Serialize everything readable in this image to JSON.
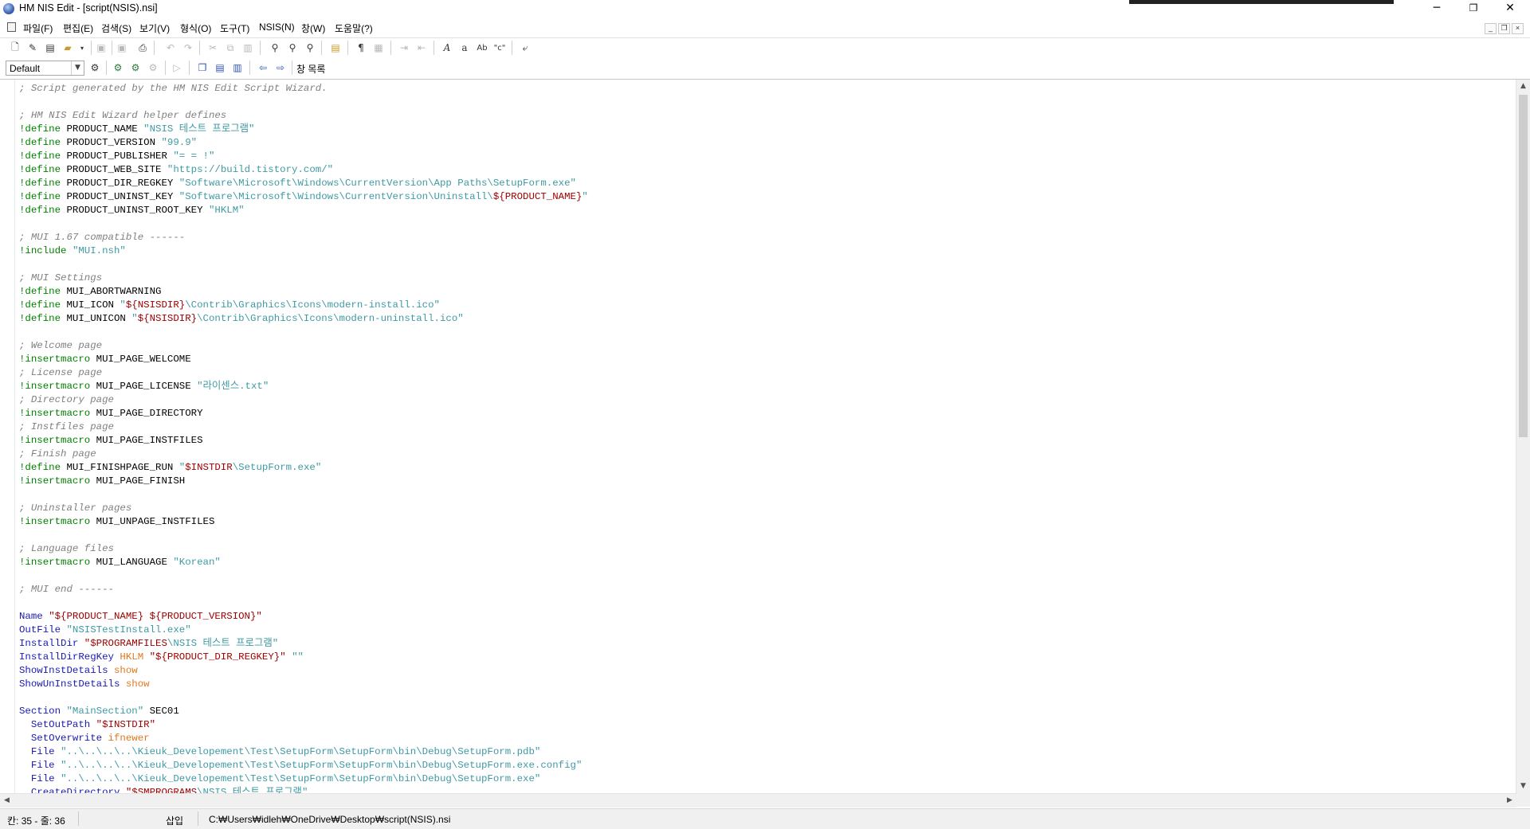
{
  "window": {
    "title": "HM NIS Edit - [script(NSIS).nsi]",
    "minimize": "─",
    "maximize": "❐",
    "close": "✕"
  },
  "menu": {
    "items": [
      "파일(F)",
      "편집(E)",
      "검색(S)",
      "보기(V)",
      "형식(O)",
      "도구(T)",
      "NSIS(N)",
      "창(W)",
      "도움말(?)"
    ],
    "mdi_min": "_",
    "mdi_restore": "❐",
    "mdi_close": "×"
  },
  "toolbar": {
    "style_combo": "Default",
    "window_list": "창 목록"
  },
  "editor": {
    "lines": [
      [
        [
          "c-com",
          "; Script generated by the HM NIS Edit Script Wizard."
        ]
      ],
      [],
      [
        [
          "c-com",
          "; HM NIS Edit Wizard helper defines"
        ]
      ],
      [
        [
          "c-kw",
          "!define"
        ],
        [
          "",
          " PRODUCT_NAME "
        ],
        [
          "c-str",
          "\"NSIS 테스트 프로그램\""
        ]
      ],
      [
        [
          "c-kw",
          "!define"
        ],
        [
          "",
          " PRODUCT_VERSION "
        ],
        [
          "c-str",
          "\"99.9\""
        ]
      ],
      [
        [
          "c-kw",
          "!define"
        ],
        [
          "",
          " PRODUCT_PUBLISHER "
        ],
        [
          "c-str",
          "\"= = !\""
        ]
      ],
      [
        [
          "c-kw",
          "!define"
        ],
        [
          "",
          " PRODUCT_WEB_SITE "
        ],
        [
          "c-str",
          "\"https://build.tistory.com/\""
        ]
      ],
      [
        [
          "c-kw",
          "!define"
        ],
        [
          "",
          " PRODUCT_DIR_REGKEY "
        ],
        [
          "c-str",
          "\"Software\\Microsoft\\Windows\\CurrentVersion\\App Paths\\SetupForm.exe\""
        ]
      ],
      [
        [
          "c-kw",
          "!define"
        ],
        [
          "",
          " PRODUCT_UNINST_KEY "
        ],
        [
          "c-str",
          "\"Software\\Microsoft\\Windows\\CurrentVersion\\Uninstall\\"
        ],
        [
          "c-var",
          "${PRODUCT_NAME}"
        ],
        [
          "c-str",
          "\""
        ]
      ],
      [
        [
          "c-kw",
          "!define"
        ],
        [
          "",
          " PRODUCT_UNINST_ROOT_KEY "
        ],
        [
          "c-str",
          "\"HKLM\""
        ]
      ],
      [],
      [
        [
          "c-com",
          "; MUI 1.67 compatible ------"
        ]
      ],
      [
        [
          "c-kw",
          "!include"
        ],
        [
          "",
          " "
        ],
        [
          "c-str",
          "\"MUI.nsh\""
        ]
      ],
      [],
      [
        [
          "c-com",
          "; MUI Settings"
        ]
      ],
      [
        [
          "c-kw",
          "!define"
        ],
        [
          "",
          " MUI_ABORTWARNING"
        ]
      ],
      [
        [
          "c-kw",
          "!define"
        ],
        [
          "",
          " MUI_ICON "
        ],
        [
          "c-str",
          "\""
        ],
        [
          "c-var",
          "${NSISDIR}"
        ],
        [
          "c-str",
          "\\Contrib\\Graphics\\Icons\\modern-install.ico\""
        ]
      ],
      [
        [
          "c-kw",
          "!define"
        ],
        [
          "",
          " MUI_UNICON "
        ],
        [
          "c-str",
          "\""
        ],
        [
          "c-var",
          "${NSISDIR}"
        ],
        [
          "c-str",
          "\\Contrib\\Graphics\\Icons\\modern-uninstall.ico\""
        ]
      ],
      [],
      [
        [
          "c-com",
          "; Welcome page"
        ]
      ],
      [
        [
          "c-kw",
          "!insertmacro"
        ],
        [
          "",
          " MUI_PAGE_WELCOME"
        ]
      ],
      [
        [
          "c-com",
          "; License page"
        ]
      ],
      [
        [
          "c-kw",
          "!insertmacro"
        ],
        [
          "",
          " MUI_PAGE_LICENSE "
        ],
        [
          "c-str",
          "\"라이센스.txt\""
        ]
      ],
      [
        [
          "c-com",
          "; Directory page"
        ]
      ],
      [
        [
          "c-kw",
          "!insertmacro"
        ],
        [
          "",
          " MUI_PAGE_DIRECTORY"
        ]
      ],
      [
        [
          "c-com",
          "; Instfiles page"
        ]
      ],
      [
        [
          "c-kw",
          "!insertmacro"
        ],
        [
          "",
          " MUI_PAGE_INSTFILES"
        ]
      ],
      [
        [
          "c-com",
          "; Finish page"
        ]
      ],
      [
        [
          "c-kw",
          "!define"
        ],
        [
          "",
          " MUI_FINISHPAGE_RUN "
        ],
        [
          "c-str",
          "\""
        ],
        [
          "c-var",
          "$INSTDIR"
        ],
        [
          "c-str",
          "\\SetupForm.exe\""
        ]
      ],
      [
        [
          "c-kw",
          "!insertmacro"
        ],
        [
          "",
          " MUI_PAGE_FINISH"
        ]
      ],
      [],
      [
        [
          "c-com",
          "; Uninstaller pages"
        ]
      ],
      [
        [
          "c-kw",
          "!insertmacro"
        ],
        [
          "",
          " MUI_UNPAGE_INSTFILES"
        ]
      ],
      [],
      [
        [
          "c-com",
          "; Language files"
        ]
      ],
      [
        [
          "c-kw",
          "!insertmacro"
        ],
        [
          "",
          " MUI_LANGUAGE "
        ],
        [
          "c-str",
          "\"Korean\""
        ]
      ],
      [],
      [
        [
          "c-com",
          "; MUI end ------"
        ]
      ],
      [],
      [
        [
          "c-cmd",
          "Name"
        ],
        [
          "",
          " "
        ],
        [
          "c-var",
          "\"${PRODUCT_NAME} ${PRODUCT_VERSION}\""
        ]
      ],
      [
        [
          "c-cmd",
          "OutFile"
        ],
        [
          "",
          " "
        ],
        [
          "c-str",
          "\"NSISTestInstall.exe\""
        ]
      ],
      [
        [
          "c-cmd",
          "InstallDir"
        ],
        [
          "",
          " "
        ],
        [
          "c-var",
          "\"$PROGRAMFILES"
        ],
        [
          "c-str",
          "\\NSIS 테스트 프로그램\""
        ]
      ],
      [
        [
          "c-cmd",
          "InstallDirRegKey"
        ],
        [
          "",
          " "
        ],
        [
          "c-opt",
          "HKLM"
        ],
        [
          "",
          " "
        ],
        [
          "c-var",
          "\"${PRODUCT_DIR_REGKEY}\""
        ],
        [
          "",
          " "
        ],
        [
          "c-str",
          "\"\""
        ]
      ],
      [
        [
          "c-cmd",
          "ShowInstDetails"
        ],
        [
          "",
          " "
        ],
        [
          "c-opt",
          "show"
        ]
      ],
      [
        [
          "c-cmd",
          "ShowUnInstDetails"
        ],
        [
          "",
          " "
        ],
        [
          "c-opt",
          "show"
        ]
      ],
      [],
      [
        [
          "c-cmd",
          "Section"
        ],
        [
          "",
          " "
        ],
        [
          "c-str",
          "\"MainSection\""
        ],
        [
          "",
          " SEC01"
        ]
      ],
      [
        [
          "",
          "  "
        ],
        [
          "c-cmd",
          "SetOutPath"
        ],
        [
          "",
          " "
        ],
        [
          "c-var",
          "\"$INSTDIR\""
        ]
      ],
      [
        [
          "",
          "  "
        ],
        [
          "c-cmd",
          "SetOverwrite"
        ],
        [
          "",
          " "
        ],
        [
          "c-opt",
          "ifnewer"
        ]
      ],
      [
        [
          "",
          "  "
        ],
        [
          "c-cmd",
          "File"
        ],
        [
          "",
          " "
        ],
        [
          "c-str",
          "\"..\\..\\..\\..\\Kieuk_Developement\\Test\\SetupForm\\SetupForm\\bin\\Debug\\SetupForm.pdb\""
        ]
      ],
      [
        [
          "",
          "  "
        ],
        [
          "c-cmd",
          "File"
        ],
        [
          "",
          " "
        ],
        [
          "c-str",
          "\"..\\..\\..\\..\\Kieuk_Developement\\Test\\SetupForm\\SetupForm\\bin\\Debug\\SetupForm.exe.config\""
        ]
      ],
      [
        [
          "",
          "  "
        ],
        [
          "c-cmd",
          "File"
        ],
        [
          "",
          " "
        ],
        [
          "c-str",
          "\"..\\..\\..\\..\\Kieuk_Developement\\Test\\SetupForm\\SetupForm\\bin\\Debug\\SetupForm.exe\""
        ]
      ],
      [
        [
          "",
          "  "
        ],
        [
          "c-cmd",
          "CreateDirectory"
        ],
        [
          "",
          " "
        ],
        [
          "c-var",
          "\"$SMPROGRAMS"
        ],
        [
          "c-str",
          "\\NSIS 테스트 프로그램\""
        ]
      ]
    ]
  },
  "status": {
    "position": "칸: 35 - 줄: 36",
    "mode": "삽입",
    "path": "C:₩Users₩idleh₩OneDrive₩Desktop₩script(NSIS).nsi"
  }
}
